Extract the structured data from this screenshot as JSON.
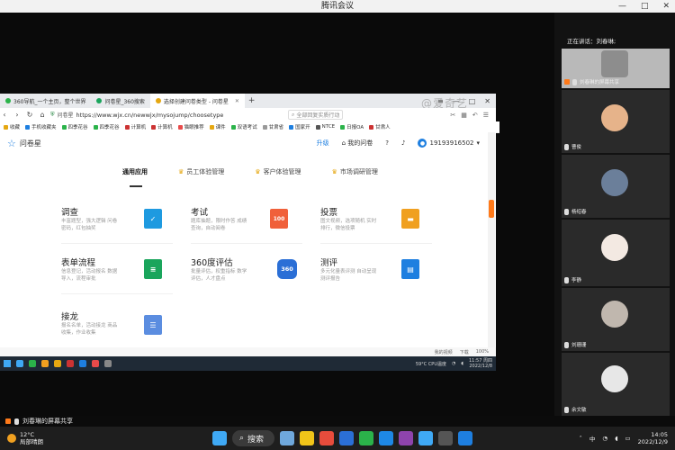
{
  "app": {
    "title": "腾讯会议",
    "controls": [
      "—",
      "□",
      "✕"
    ]
  },
  "browser": {
    "tabs": [
      {
        "label": "360导航_一个主页，整个世界",
        "icon_color": "#2bb34a"
      },
      {
        "label": "问卷星_360搜索",
        "icon_color": "#1aa55c"
      },
      {
        "label": "选择创建问卷类型 - 问卷星",
        "icon_color": "#e5a711",
        "active": true
      }
    ],
    "tab_add": "+",
    "window_controls": [
      "≡",
      "—",
      "□",
      "✕"
    ],
    "watermark": "@爱奇艺",
    "url_host": "问卷星",
    "url": "https://www.wjx.cn/newwjx/mysojump/choosetype",
    "search_placeholder": "全部回复实质行动",
    "bookmarks": [
      {
        "label": "收藏",
        "color": "#e5a711"
      },
      {
        "label": "手机收藏夹",
        "color": "#1e7fe0"
      },
      {
        "label": "四季花谷",
        "color": "#2bb34a"
      },
      {
        "label": "四季花谷",
        "color": "#2bb34a"
      },
      {
        "label": "计算机",
        "color": "#cc3333"
      },
      {
        "label": "计算机",
        "color": "#cc3333"
      },
      {
        "label": "猫眼推荐",
        "color": "#e84a4a"
      },
      {
        "label": "课件",
        "color": "#e5a711"
      },
      {
        "label": "双语考试",
        "color": "#2bb34a"
      },
      {
        "label": "甘肃省",
        "color": "#999999"
      },
      {
        "label": "国家开",
        "color": "#1e7fe0"
      },
      {
        "label": "NTCE",
        "color": "#555555"
      },
      {
        "label": "日报OA",
        "color": "#2bb34a"
      },
      {
        "label": "甘肃人",
        "color": "#cc3333"
      }
    ],
    "status_items": [
      "我的视频",
      "下载",
      "100%"
    ]
  },
  "page": {
    "logo": "问卷星",
    "header_right": {
      "upgrade": "升级",
      "my_survey": "我的问卷",
      "phone": "19193916502"
    },
    "nav": [
      {
        "label": "通用应用",
        "active": true
      },
      {
        "label": "员工体验管理",
        "crown": true
      },
      {
        "label": "客户体验管理",
        "crown": true
      },
      {
        "label": "市场调研管理",
        "crown": true
      }
    ],
    "apps": [
      {
        "name": "调查",
        "desc": "丰富题型，强大逻辑 问卷密码，红包抽奖",
        "icon_color": "#1e9ae0",
        "icon_text": "✓"
      },
      {
        "name": "考试",
        "desc": "题库抽题，限时作答 成绩查询，自动阅卷",
        "icon_color": "#f0603a",
        "icon_text": "100"
      },
      {
        "name": "投票",
        "desc": "图文视频，选项随机 实时排行，微信投票",
        "icon_color": "#f0a020",
        "icon_text": "▬"
      },
      {
        "name": "表单流程",
        "desc": "信息登记，活动报名 数据导入，流程审批",
        "icon_color": "#1aa55c",
        "icon_text": "≡"
      },
      {
        "name": "360度评估",
        "desc": "批量评估，权重指标 数学评估，人才盘点",
        "icon_color": "#2b6fd6",
        "icon_text": "360"
      },
      {
        "name": "测评",
        "desc": "多元化量表评测 自动呈现测评报告",
        "icon_color": "#1e7fe0",
        "icon_text": "▤"
      },
      {
        "name": "接龙",
        "desc": "报名名单，活动接龙 商品收集，作业收集",
        "icon_color": "#5b8de0",
        "icon_text": "☰"
      }
    ]
  },
  "inner_taskbar": {
    "icons": [
      "#3fa9f5",
      "#2bb34a",
      "#f0a020",
      "#e5a711",
      "#cc3333",
      "#1e7fe0",
      "#e84a4a",
      "#888888"
    ],
    "weather": "59°C CPU温度",
    "time": "11:57 周四",
    "date": "2022/12/8"
  },
  "sidebar": {
    "speaking": "正在讲话：刘春琳;",
    "participants": [
      {
        "name": "刘春琳的屏幕共享",
        "sharing": true,
        "bg": "#b9b9b9",
        "photo_color": "#8d8d8d"
      },
      {
        "name": "曹俊",
        "bg": "#2a2a2a",
        "photo_color": "#e6b38a"
      },
      {
        "name": "杨绍春",
        "bg": "#2a2a2a",
        "photo_color": "#6b7f9a"
      },
      {
        "name": "李静",
        "bg": "#2a2a2a",
        "photo_color": "#f3e9e2"
      },
      {
        "name": "刘珊珊",
        "bg": "#2a2a2a",
        "photo_color": "#c0b7ae"
      },
      {
        "name": "余文敏",
        "bg": "#2a2a2a",
        "photo_color": "#e7e7e7"
      }
    ]
  },
  "sharing_bar": {
    "label": "刘春琳的屏幕共享"
  },
  "windows_taskbar": {
    "weather": {
      "temp": "12°C",
      "desc": "局部晴朗"
    },
    "search_label": "搜索",
    "apps": [
      "#6fa8dc",
      "#f0c419",
      "#e74c3c",
      "#2b6fd6",
      "#2bb34a",
      "#1e88e5",
      "#8e44ad",
      "#3fa9f5",
      "#555555",
      "#1e7fe0",
      "#333333"
    ],
    "lang": "中",
    "time": "14:05",
    "date": "2022/12/9"
  }
}
